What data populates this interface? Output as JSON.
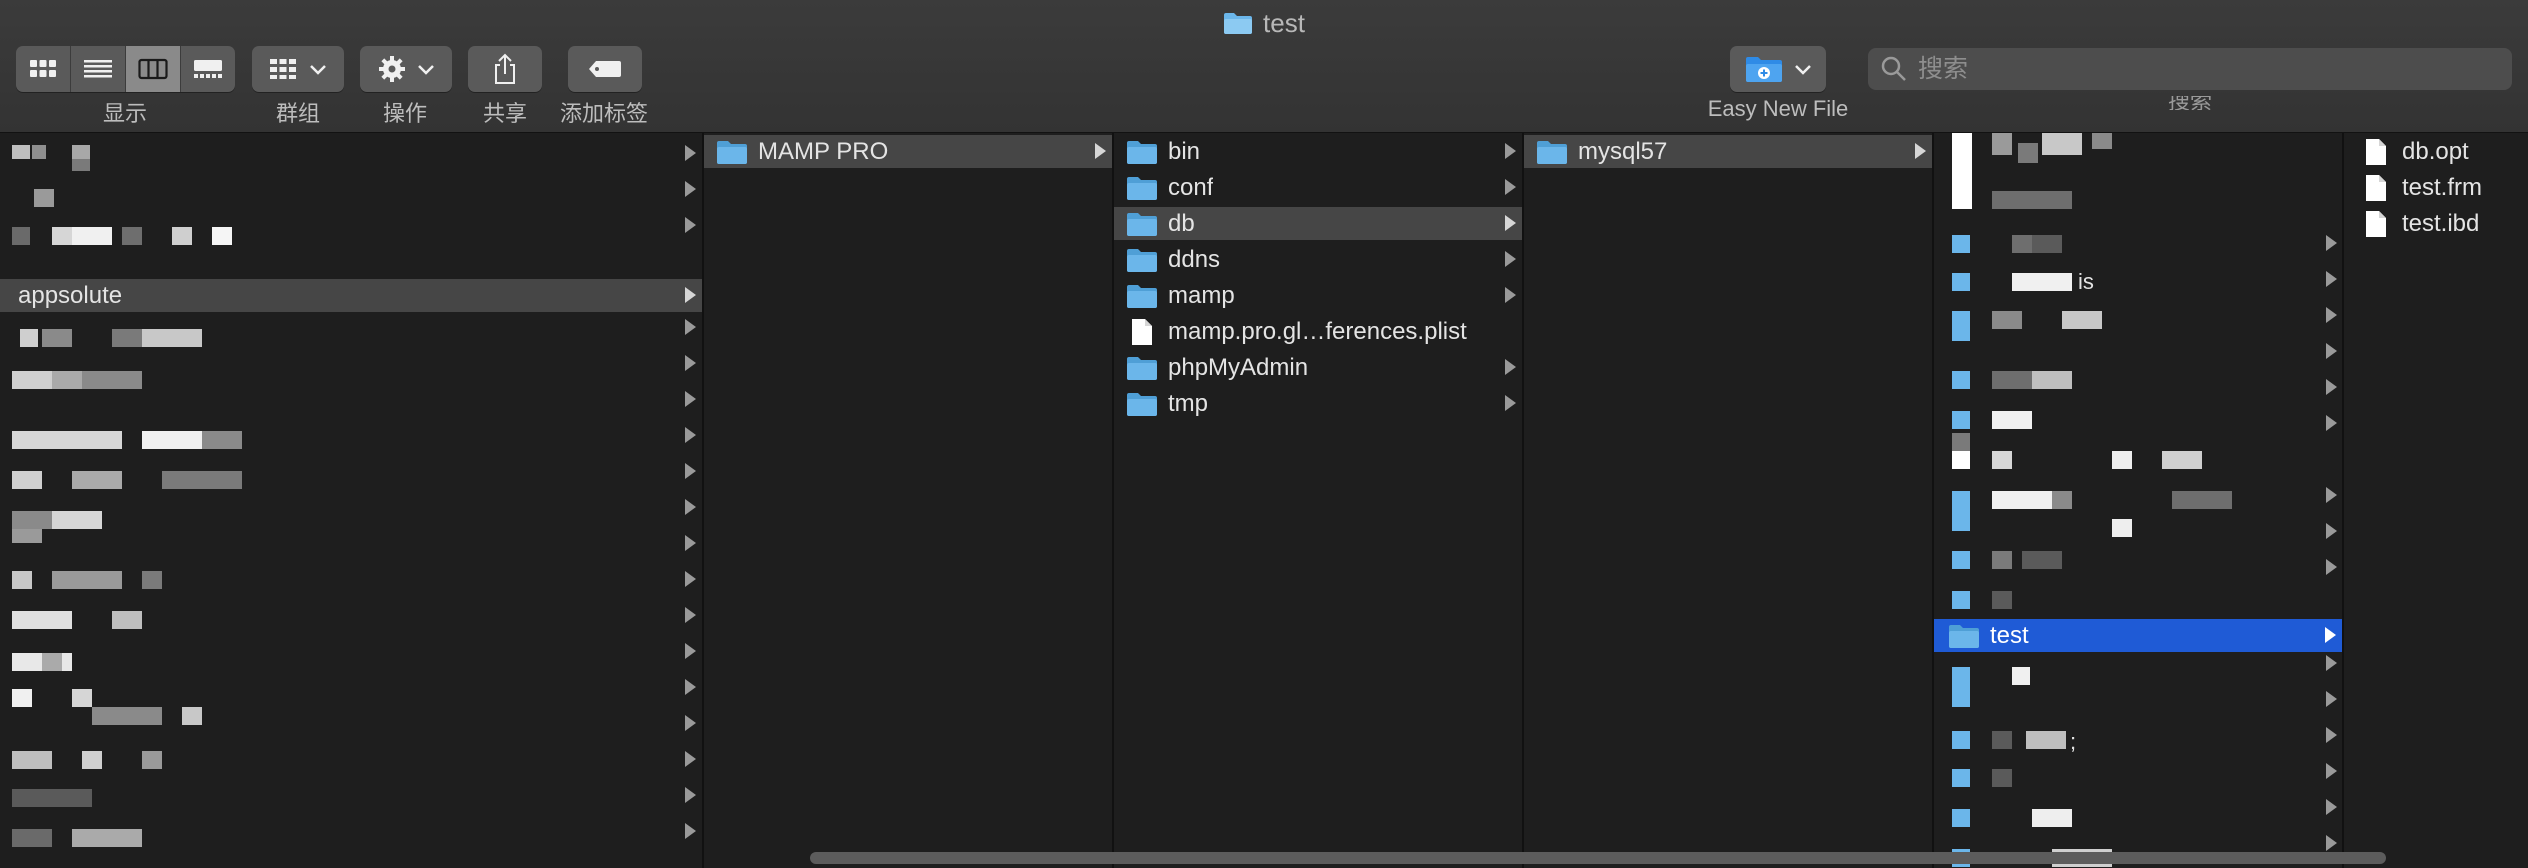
{
  "window": {
    "title": "test"
  },
  "toolbar": {
    "view_label": "显示",
    "group_label": "群组",
    "action_label": "操作",
    "share_label": "共享",
    "tags_label": "添加标签",
    "easy_new_file_label": "Easy New File",
    "search_placeholder": "搜索",
    "search_label": "搜索"
  },
  "columns": {
    "col1": {
      "selected": "appsolute"
    },
    "col2": {
      "items": [
        {
          "name": "MAMP PRO"
        }
      ]
    },
    "col3": {
      "items": [
        {
          "name": "bin"
        },
        {
          "name": "conf"
        },
        {
          "name": "db"
        },
        {
          "name": "ddns"
        },
        {
          "name": "mamp"
        },
        {
          "name": "mamp.pro.gl…ferences.plist"
        },
        {
          "name": "phpMyAdmin"
        },
        {
          "name": "tmp"
        }
      ]
    },
    "col4": {
      "items": [
        {
          "name": "mysql57"
        }
      ]
    },
    "col5": {
      "partial_text": "is",
      "partial_text2": ";",
      "selected": "test"
    },
    "col6": {
      "items": [
        {
          "name": "db.opt"
        },
        {
          "name": "test.frm"
        },
        {
          "name": "test.ibd"
        }
      ]
    }
  },
  "colors": {
    "selection": "#1f5bd6",
    "folder": "#6bb6ea",
    "highlight": "#464646"
  }
}
